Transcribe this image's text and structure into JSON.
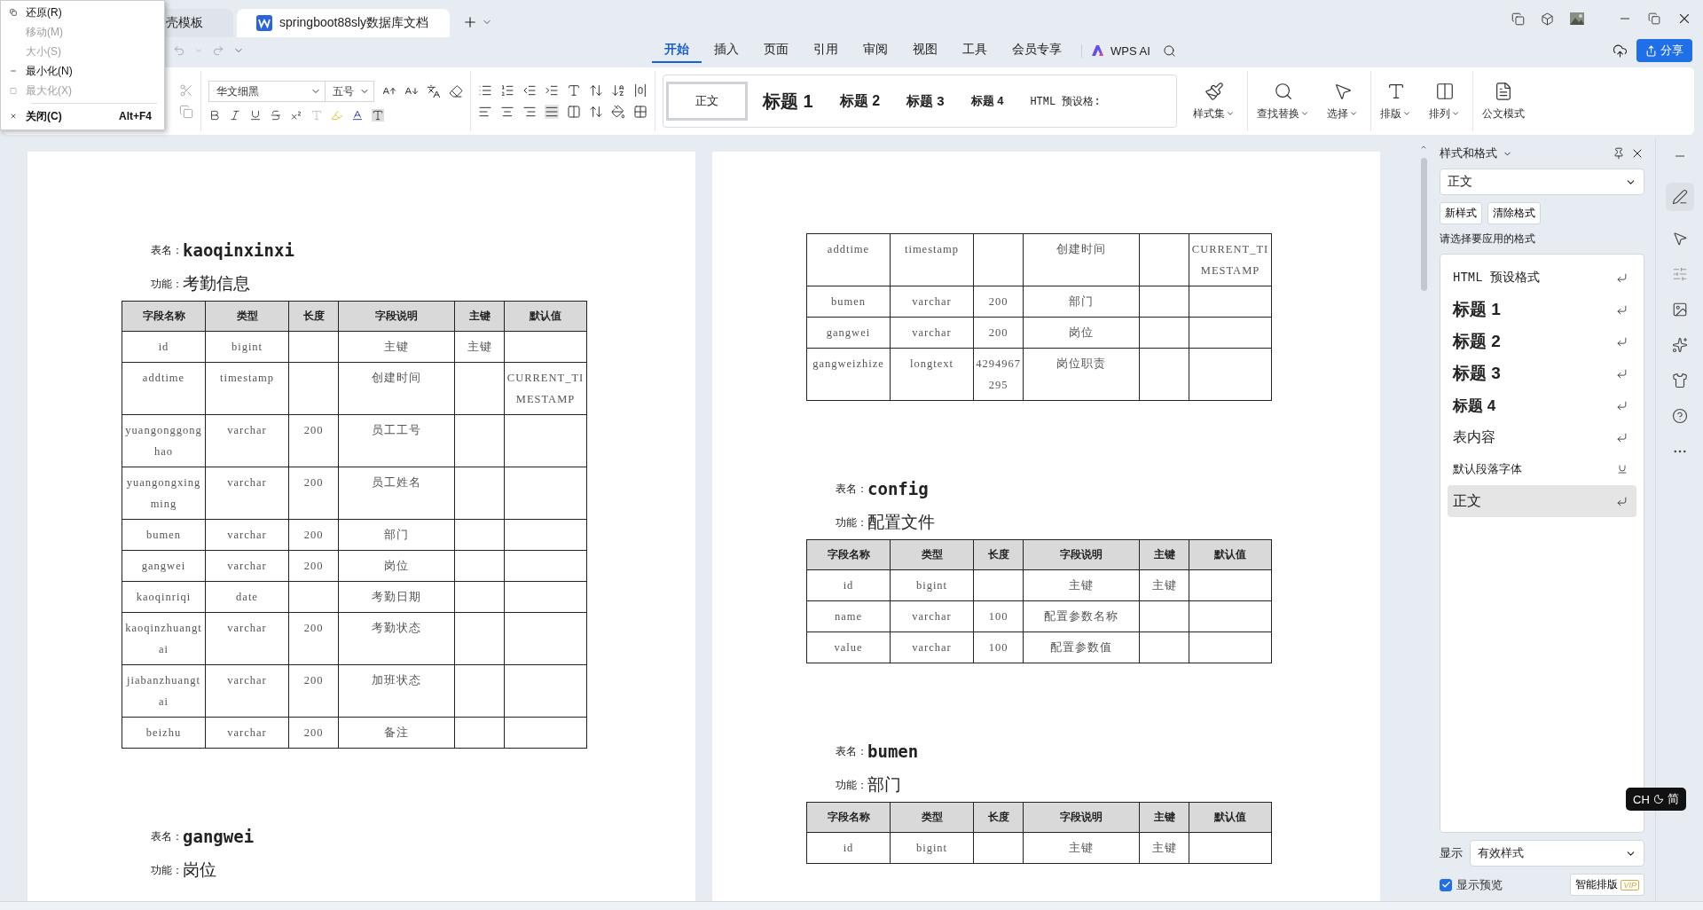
{
  "system_menu": {
    "items": [
      {
        "label": "还原(R)",
        "disabled": false,
        "bold": false
      },
      {
        "label": "移动(M)",
        "disabled": true,
        "bold": false
      },
      {
        "label": "大小(S)",
        "disabled": true,
        "bold": false
      },
      {
        "label": "最小化(N)",
        "disabled": false,
        "bold": false
      },
      {
        "label": "最大化(X)",
        "disabled": true,
        "bold": false
      },
      {
        "label": "关闭(C)",
        "shortcut": "Alt+F4",
        "disabled": false,
        "bold": true
      }
    ]
  },
  "tabs": [
    {
      "label": "壳模板",
      "selected": false
    },
    {
      "label": "springboot88sly数据库文档",
      "selected": true
    }
  ],
  "ribbon_tabs": [
    {
      "label": "开始",
      "selected": true
    },
    {
      "label": "插入",
      "selected": false
    },
    {
      "label": "页面",
      "selected": false
    },
    {
      "label": "引用",
      "selected": false
    },
    {
      "label": "审阅",
      "selected": false
    },
    {
      "label": "视图",
      "selected": false
    },
    {
      "label": "工具",
      "selected": false
    },
    {
      "label": "会员专享",
      "selected": false
    }
  ],
  "ai_button": "WPS AI",
  "share_button": "分享",
  "font": {
    "name": "华文细黑",
    "size": "五号"
  },
  "style_gallery": [
    {
      "label": "正文",
      "selected": true
    },
    {
      "label": "标题 1",
      "selected": false
    },
    {
      "label": "标题 2",
      "selected": false
    },
    {
      "label": "标题 3",
      "selected": false
    },
    {
      "label": "标题 4",
      "selected": false
    },
    {
      "label": "HTML 预设格:",
      "selected": false
    }
  ],
  "big_buttons": [
    {
      "label": "样式集",
      "dropdown": true
    },
    {
      "label": "查找替换",
      "dropdown": true
    },
    {
      "label": "选择",
      "dropdown": true
    },
    {
      "label": "排版",
      "dropdown": true
    },
    {
      "label": "排列",
      "dropdown": true
    },
    {
      "label": "公文模式",
      "dropdown": false
    }
  ],
  "pages": [
    {
      "blocks": [
        {
          "kind": "table_name",
          "label": "表名：",
          "value": "kaoqinxinxi"
        },
        {
          "kind": "function",
          "label": "功能：",
          "value": "考勤信息"
        },
        {
          "kind": "table",
          "columns": [
            "字段名称",
            "类型",
            "长度",
            "字段说明",
            "主键",
            "默认值"
          ],
          "rows": [
            [
              "id",
              "bigint",
              "",
              "主键",
              "主键",
              ""
            ],
            [
              "addtime",
              "timestamp",
              "",
              "创建时间",
              "",
              "CURRENT_TIMESTAMP"
            ],
            [
              "yuangonggonghao",
              "varchar",
              "200",
              "员工工号",
              "",
              ""
            ],
            [
              "yuangongxingming",
              "varchar",
              "200",
              "员工姓名",
              "",
              ""
            ],
            [
              "bumen",
              "varchar",
              "200",
              "部门",
              "",
              ""
            ],
            [
              "gangwei",
              "varchar",
              "200",
              "岗位",
              "",
              ""
            ],
            [
              "kaoqinriqi",
              "date",
              "",
              "考勤日期",
              "",
              ""
            ],
            [
              "kaoqinzhuangtai",
              "varchar",
              "200",
              "考勤状态",
              "",
              ""
            ],
            [
              "jiabanzhuangtai",
              "varchar",
              "200",
              "加班状态",
              "",
              ""
            ],
            [
              "beizhu",
              "varchar",
              "200",
              "备注",
              "",
              ""
            ]
          ]
        },
        {
          "kind": "table_name",
          "label": "表名：",
          "value": "gangwei"
        },
        {
          "kind": "function",
          "label": "功能：",
          "value": "岗位"
        }
      ]
    },
    {
      "blocks": [
        {
          "kind": "table",
          "rows": [
            [
              "addtime",
              "timestamp",
              "",
              "创建时间",
              "",
              "CURRENT_TIMESTAMP"
            ],
            [
              "bumen",
              "varchar",
              "200",
              "部门",
              "",
              ""
            ],
            [
              "gangwei",
              "varchar",
              "200",
              "岗位",
              "",
              ""
            ],
            [
              "gangweizhize",
              "longtext",
              "4294967295",
              "岗位职责",
              "",
              ""
            ]
          ]
        },
        {
          "kind": "table_name",
          "label": "表名：",
          "value": "config"
        },
        {
          "kind": "function",
          "label": "功能：",
          "value": "配置文件"
        },
        {
          "kind": "table",
          "columns": [
            "字段名称",
            "类型",
            "长度",
            "字段说明",
            "主键",
            "默认值"
          ],
          "rows": [
            [
              "id",
              "bigint",
              "",
              "主键",
              "主键",
              ""
            ],
            [
              "name",
              "varchar",
              "100",
              "配置参数名称",
              "",
              ""
            ],
            [
              "value",
              "varchar",
              "100",
              "配置参数值",
              "",
              ""
            ]
          ]
        },
        {
          "kind": "table_name",
          "label": "表名：",
          "value": "bumen"
        },
        {
          "kind": "function",
          "label": "功能：",
          "value": "部门"
        },
        {
          "kind": "table",
          "columns": [
            "字段名称",
            "类型",
            "长度",
            "字段说明",
            "主键",
            "默认值"
          ],
          "rows": [
            [
              "id",
              "bigint",
              "",
              "主键",
              "主键",
              ""
            ]
          ]
        }
      ]
    }
  ],
  "style_panel": {
    "title": "样式和格式",
    "current": "正文",
    "buttons": [
      "新样式",
      "清除格式"
    ],
    "prompt": "请选择要应用的格式",
    "styles": [
      {
        "label": "HTML 预设格式",
        "kind": "paragraph",
        "selected": false
      },
      {
        "label": "标题 1",
        "kind": "paragraph",
        "selected": false
      },
      {
        "label": "标题 2",
        "kind": "paragraph",
        "selected": false
      },
      {
        "label": "标题 3",
        "kind": "paragraph",
        "selected": false
      },
      {
        "label": "标题 4",
        "kind": "paragraph",
        "selected": false
      },
      {
        "label": "表内容",
        "kind": "paragraph",
        "selected": false
      },
      {
        "label": "默认段落字体",
        "kind": "character",
        "selected": false
      },
      {
        "label": "正文",
        "kind": "paragraph",
        "selected": true
      }
    ],
    "show_label": "显示",
    "show_value": "有效样式",
    "preview": {
      "label": "显示预览",
      "checked": true
    },
    "smart_button": "智能排版",
    "vip_badge": "VIP"
  },
  "ime_indicator": {
    "mode": "CH",
    "script": "简"
  }
}
